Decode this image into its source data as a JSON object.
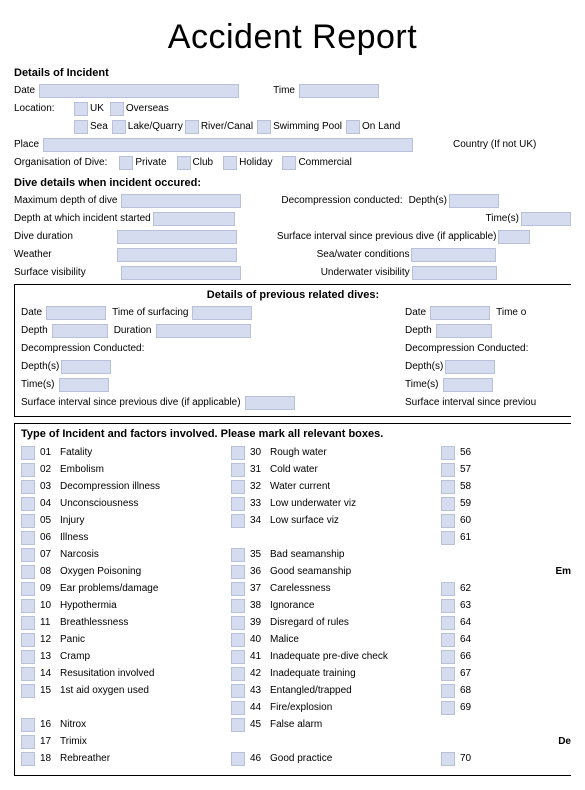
{
  "title": "Accident Report",
  "sections": {
    "details": "Details of Incident",
    "dive": "Dive details when incident occured:",
    "prev": "Details of previous related dives:",
    "factors": "Type of Incident and factors involved. Please mark all relevant boxes."
  },
  "labels": {
    "date": "Date",
    "time": "Time",
    "location": "Location:",
    "uk": "UK",
    "overseas": "Overseas",
    "sea": "Sea",
    "lakequarry": "Lake/Quarry",
    "rivercanal": "River/Canal",
    "swimming": "Swimming Pool",
    "onland": "On Land",
    "place": "Place",
    "country": "Country (If not UK)",
    "org": "Organisation of Dive:",
    "private": "Private",
    "club": "Club",
    "holiday": "Holiday",
    "commercial": "Commercial",
    "maxdepth": "Maximum depth of dive",
    "decomp": "Decompression conducted:",
    "depths": "Depth(s)",
    "times": "Time(s)",
    "incidentdepth": "Depth at which incident started",
    "diveduration": "Dive duration",
    "surfaceinterval": "Surface interval since previous dive (if applicable)",
    "weather": "Weather",
    "seawater": "Sea/water conditions",
    "surfacevis": "Surface visibility",
    "underwatervis": "Underwater visibility",
    "timesurf": "Time of surfacing",
    "timeo": "Time o",
    "depth": "Depth",
    "duration": "Duration",
    "decompconducted": "Decompression Conducted:",
    "surfaceinterval2": "Surface interval since previous dive (if applicable)",
    "surfaceinterval3": "Surface interval since previou",
    "em": "Em",
    "dec": "De"
  },
  "factors_col1": [
    {
      "n": "01",
      "t": "Fatality"
    },
    {
      "n": "02",
      "t": "Embolism"
    },
    {
      "n": "03",
      "t": "Decompression illness"
    },
    {
      "n": "04",
      "t": "Unconsciousness"
    },
    {
      "n": "05",
      "t": "Injury"
    },
    {
      "n": "06",
      "t": "Illness"
    },
    {
      "n": "07",
      "t": "Narcosis"
    },
    {
      "n": "08",
      "t": "Oxygen Poisoning"
    },
    {
      "n": "09",
      "t": "Ear problems/damage"
    },
    {
      "n": "10",
      "t": "Hypothermia"
    },
    {
      "n": "11",
      "t": "Breathlessness"
    },
    {
      "n": "12",
      "t": "Panic"
    },
    {
      "n": "13",
      "t": "Cramp"
    },
    {
      "n": "14",
      "t": "Resusitation involved"
    },
    {
      "n": "15",
      "t": "1st aid oxygen used"
    },
    {
      "n": "16",
      "t": "Nitrox"
    },
    {
      "n": "17",
      "t": "Trimix"
    },
    {
      "n": "18",
      "t": "Rebreather"
    }
  ],
  "factors_col2": [
    {
      "n": "30",
      "t": "Rough water"
    },
    {
      "n": "31",
      "t": "Cold water"
    },
    {
      "n": "32",
      "t": "Water current"
    },
    {
      "n": "33",
      "t": "Low underwater viz"
    },
    {
      "n": "34",
      "t": "Low surface viz"
    },
    {
      "n": "35",
      "t": "Bad seamanship"
    },
    {
      "n": "36",
      "t": "Good seamanship"
    },
    {
      "n": "37",
      "t": "Carelessness"
    },
    {
      "n": "38",
      "t": "Ignorance"
    },
    {
      "n": "39",
      "t": "Disregard of rules"
    },
    {
      "n": "40",
      "t": "Malice"
    },
    {
      "n": "41",
      "t": "Inadequate pre-dive check"
    },
    {
      "n": "42",
      "t": "Inadequate training"
    },
    {
      "n": "43",
      "t": "Entangled/trapped"
    },
    {
      "n": "44",
      "t": "Fire/explosion"
    },
    {
      "n": "45",
      "t": "False alarm"
    },
    {
      "n": "46",
      "t": "Good practice"
    }
  ],
  "factors_col3": [
    "56",
    "57",
    "58",
    "59",
    "60",
    "61",
    "62",
    "63",
    "64",
    "64",
    "66",
    "67",
    "68",
    "69",
    "70"
  ]
}
